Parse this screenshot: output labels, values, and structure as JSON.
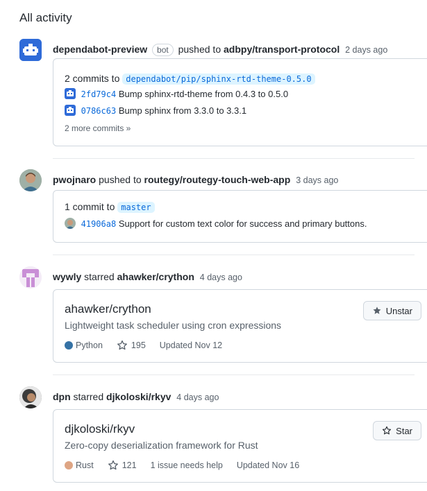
{
  "page": {
    "title": "All activity"
  },
  "events": [
    {
      "actor": "dependabot-preview",
      "badge": "bot",
      "verb": "pushed to",
      "repo": "adbpy/transport-protocol",
      "time": "2 days ago",
      "summary_prefix": "2 commits to",
      "branch": "dependabot/pip/sphinx-rtd-theme-0.5.0",
      "commits": [
        {
          "sha": "2fd79c4",
          "message": "Bump sphinx-rtd-theme from 0.4.3 to 0.5.0"
        },
        {
          "sha": "0786c63",
          "message": "Bump sphinx from 3.3.0 to 3.3.1"
        }
      ],
      "more": "2 more commits »"
    },
    {
      "actor": "pwojnaro",
      "verb": "pushed to",
      "repo": "routegy/routegy-touch-web-app",
      "time": "3 days ago",
      "summary_prefix": "1 commit to",
      "branch": "master",
      "commits": [
        {
          "sha": "41906a8",
          "message": "Support for custom text color for success and primary buttons."
        }
      ]
    },
    {
      "actor": "wywly",
      "verb": "starred",
      "repo": "ahawker/crython",
      "time": "4 days ago",
      "card": {
        "title": "ahawker/crython",
        "description": "Lightweight task scheduler using cron expressions",
        "language": "Python",
        "language_color": "#3572A5",
        "stars": "195",
        "updated": "Updated Nov 12",
        "button": "Unstar"
      }
    },
    {
      "actor": "dpn",
      "verb": "starred",
      "repo": "djkoloski/rkyv",
      "time": "4 days ago",
      "card": {
        "title": "djkoloski/rkyv",
        "description": "Zero-copy deserialization framework for Rust",
        "language": "Rust",
        "language_color": "#dea584",
        "stars": "121",
        "issues": "1 issue needs help",
        "updated": "Updated Nov 16",
        "button": "Star"
      }
    }
  ]
}
